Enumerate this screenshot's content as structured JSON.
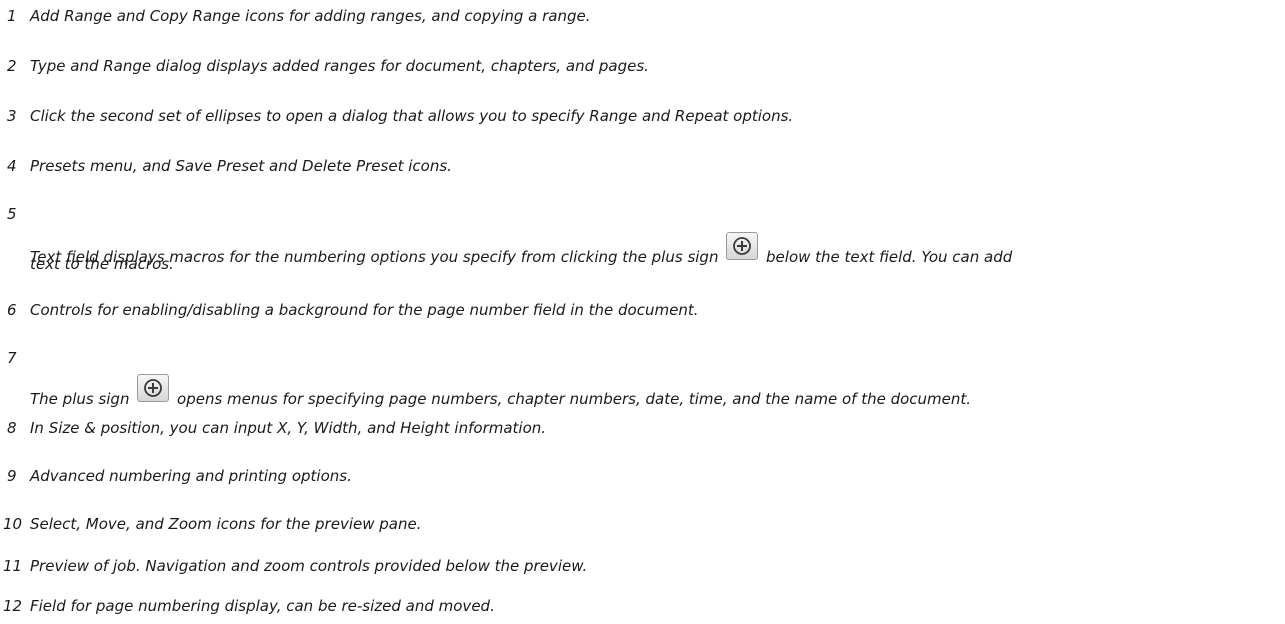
{
  "items": [
    {
      "n": "1",
      "text": "Add Range and Copy Range icons for adding ranges, and copying a range."
    },
    {
      "n": "2",
      "text": "Type and Range dialog displays added ranges for document, chapters, and pages."
    },
    {
      "n": "3",
      "text": "Click the second set of ellipses to open a dialog that allows you to specify Range and Repeat options."
    },
    {
      "n": "4",
      "text": "Presets menu, and Save Preset and Delete Preset icons."
    },
    {
      "n": "5",
      "text_before": "Text field displays macros for the numbering options you specify from clicking the plus sign",
      "text_after": "below the text field. You can add",
      "text_line2": "text to the macros."
    },
    {
      "n": "6",
      "text": "Controls for enabling/disabling a background for the page number field in the document."
    },
    {
      "n": "7",
      "text_before": "The plus sign",
      "text_after": "opens menus for specifying page numbers, chapter numbers, date, time, and the name of the document."
    },
    {
      "n": "8",
      "text": "In Size & position, you can input X, Y, Width, and Height information."
    },
    {
      "n": "9",
      "text": "Advanced numbering and printing options."
    },
    {
      "n": "10",
      "text": "Select, Move, and Zoom icons for the preview pane."
    },
    {
      "n": "11",
      "text": "Preview of job. Navigation and zoom controls provided below the preview."
    },
    {
      "n": "12",
      "text": "Field for page numbering display, can be re-sized and moved."
    }
  ],
  "icons": {
    "plus": "plus-circle-icon"
  }
}
